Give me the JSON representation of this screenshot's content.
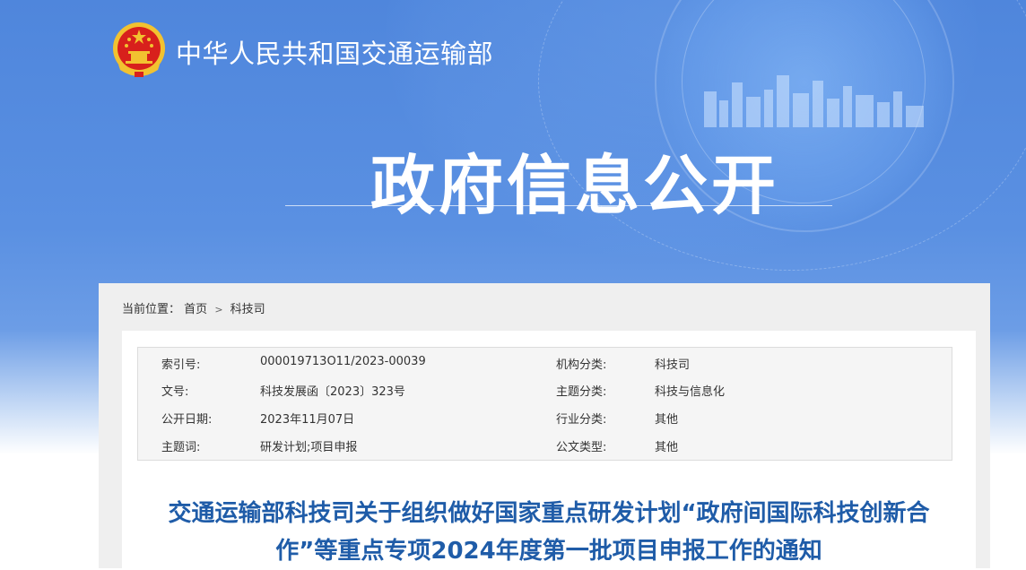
{
  "header": {
    "ministry_name": "中华人民共和国交通运输部",
    "section_title": "政府信息公开"
  },
  "breadcrumb": {
    "label": "当前位置：",
    "items": [
      "首页",
      "科技司"
    ],
    "separator": ">"
  },
  "meta": {
    "rows": [
      {
        "label": "索引号:",
        "value": "000019713O11/2023-00039",
        "label2": "机构分类:",
        "value2": "科技司"
      },
      {
        "label": "文号:",
        "value": "科技发展函〔2023〕323号",
        "label2": "主题分类:",
        "value2": "科技与信息化"
      },
      {
        "label": "公开日期:",
        "value": "2023年11月07日",
        "label2": "行业分类:",
        "value2": "其他"
      },
      {
        "label": "主题词:",
        "value": "研发计划;项目申报",
        "label2": "公文类型:",
        "value2": "其他"
      }
    ]
  },
  "document": {
    "title_line1": "交通运输部科技司关于组织做好国家重点研发计划“政府间国际科技创新合",
    "title_line2": "作”等重点专项2024年度第一批项目申报工作的通知"
  },
  "colors": {
    "banner_blue": "#4f86dc",
    "title_blue": "#1f5ca8",
    "emblem_red": "#d8201c",
    "emblem_gold": "#f2c230"
  },
  "icons": {
    "emblem": "national-emblem-icon",
    "skyline": "city-skyline-graphic"
  }
}
